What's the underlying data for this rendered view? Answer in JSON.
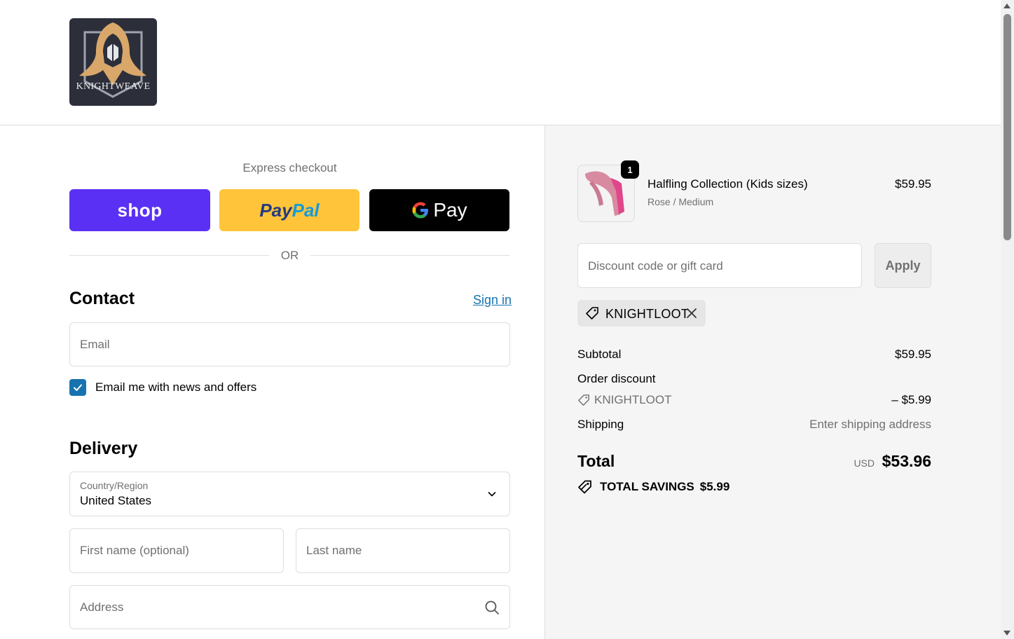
{
  "brand": {
    "logo_text": "KNIGHTWEAVE"
  },
  "express": {
    "title": "Express checkout",
    "shop_label": "shop",
    "paypal_part1": "Pay",
    "paypal_part2": "Pal",
    "gpay_label": "Pay",
    "or_label": "OR"
  },
  "contact": {
    "title": "Contact",
    "signin_label": "Sign in",
    "email_placeholder": "Email",
    "newsletter_label": "Email me with news and offers",
    "newsletter_checked": true
  },
  "delivery": {
    "title": "Delivery",
    "country_label": "Country/Region",
    "country_value": "United States",
    "first_name_placeholder": "First name (optional)",
    "last_name_placeholder": "Last name",
    "address_placeholder": "Address"
  },
  "cart": {
    "items": [
      {
        "name": "Halfling Collection (Kids sizes)",
        "variant": "Rose / Medium",
        "price": "$59.95",
        "quantity": "1"
      }
    ]
  },
  "discount": {
    "placeholder": "Discount code or gift card",
    "apply_label": "Apply",
    "applied_code": "KNIGHTLOOT"
  },
  "summary": {
    "subtotal_label": "Subtotal",
    "subtotal_value": "$59.95",
    "order_discount_label": "Order discount",
    "discount_code": "KNIGHTLOOT",
    "discount_value": "– $5.99",
    "shipping_label": "Shipping",
    "shipping_value": "Enter shipping address",
    "total_label": "Total",
    "total_currency": "USD",
    "total_value": "$53.96",
    "savings_label": "TOTAL SAVINGS",
    "savings_value": "$5.99"
  },
  "colors": {
    "shop_purple": "#5a31f4",
    "paypal_yellow": "#ffc439",
    "link_blue": "#1773b0",
    "summary_bg": "#f5f5f5"
  }
}
